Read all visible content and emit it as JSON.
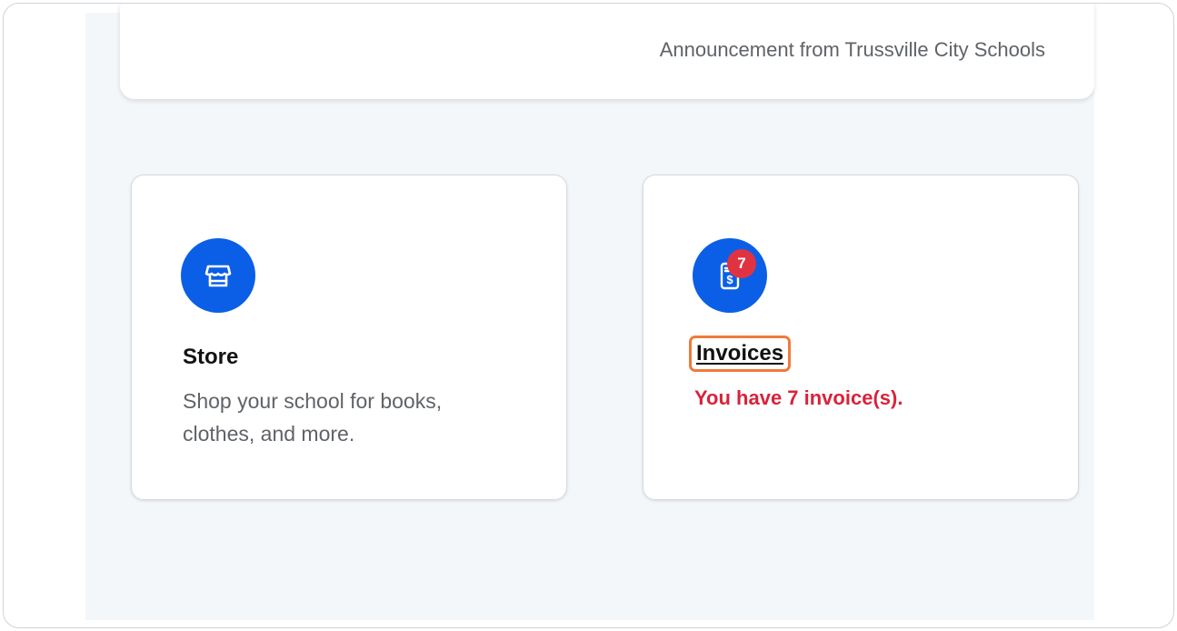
{
  "announcement": {
    "text": "Announcement from Trussville City Schools"
  },
  "cards": {
    "store": {
      "icon": "storefront-icon",
      "title": "Store",
      "description": "Shop your school for books, clothes, and more."
    },
    "invoices": {
      "icon": "invoice-dollar-icon",
      "badge_count": "7",
      "title": "Invoices",
      "status": "You have 7 invoice(s)."
    }
  },
  "colors": {
    "accent_blue": "#0b5fe6",
    "badge_red": "#e03342",
    "status_red": "#d8233a",
    "highlight_orange": "#f07a3a"
  }
}
